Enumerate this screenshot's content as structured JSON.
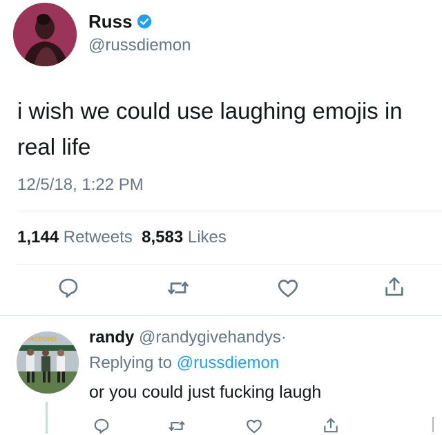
{
  "tweet": {
    "author_name": "Russ",
    "handle": "@russdiemon",
    "text": "i wish we could use laughing emojis in real life",
    "timestamp": "12/5/18, 1:22 PM",
    "retweet_count": "1,144",
    "retweet_label": "Retweets",
    "like_count": "8,583",
    "like_label": "Likes"
  },
  "reply": {
    "author_name": "randy",
    "handle": "@randygivehandys",
    "separator": "·",
    "replying_prefix": "Replying to",
    "replying_handle": "@russdiemon",
    "text": "or you could just fucking laugh",
    "avatar_text": "SURCROND"
  },
  "icons": {
    "reply": "reply-icon",
    "retweet": "retweet-icon",
    "like": "heart-icon",
    "share": "share-icon",
    "verified": "verified-badge-icon"
  },
  "colors": {
    "text": "#14171a",
    "secondary": "#657786",
    "link": "#1da1f2",
    "icon": "#657786",
    "divider": "#e6ecf0"
  }
}
